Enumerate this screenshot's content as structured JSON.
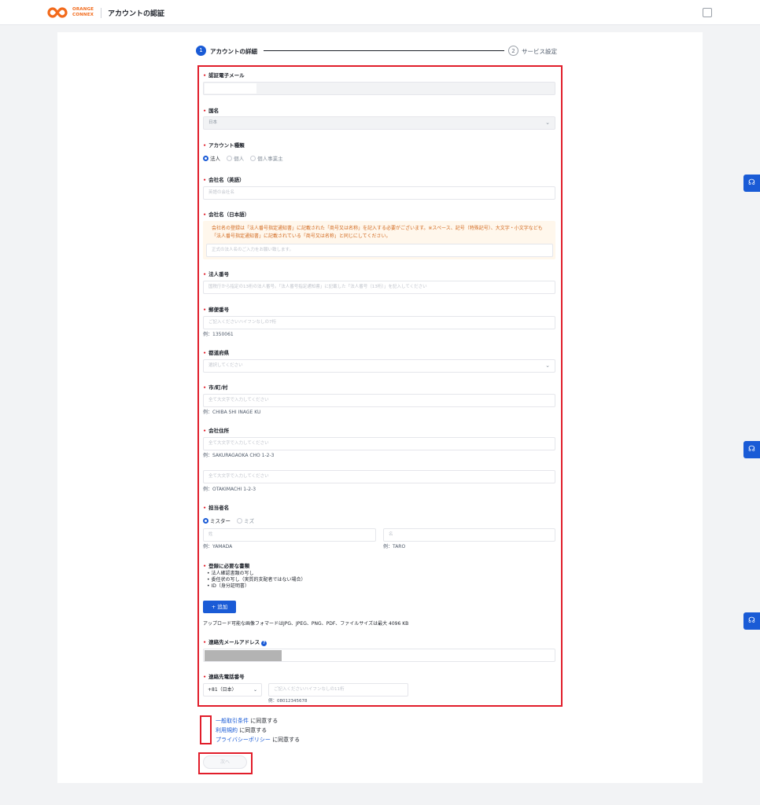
{
  "header": {
    "logo_text_line1": "ORANGE",
    "logo_text_line2": "CONNEX",
    "title": "アカウントの認証",
    "brand_color": "#f26a1b"
  },
  "steps": [
    {
      "number": "1",
      "label": "アカウントの詳細"
    },
    {
      "number": "2",
      "label": "サービス設定"
    }
  ],
  "form": {
    "email": {
      "label": "認証電子メール"
    },
    "country": {
      "label": "国名",
      "value": "日本"
    },
    "account_type": {
      "label": "アカウント種類",
      "options": [
        "法人",
        "個人",
        "個人事業主"
      ]
    },
    "company_en": {
      "label": "会社名（英語）",
      "placeholder": "英語の会社名"
    },
    "company_ja": {
      "label": "会社名（日本語）",
      "notice": "会社名の登録は「法人番号指定通知書」に記載された「商号又は名称」を記入する必要がございます。※スペース、記号（特殊記号）、大文字・小文字なども「法人番号指定通知書」に記載されている「商号又は名称」と同じにしてください。",
      "placeholder": "正式の法人名のご入力をお願い致します。"
    },
    "corp_number": {
      "label": "法人番号",
      "placeholder": "国税庁から指定の13桁の法人番号。「法人番号指定通知書」に記載した「法人番号（13桁）」を記入してください"
    },
    "postal": {
      "label": "郵便番号",
      "placeholder": "ご記入くださいハイフンなしの7桁",
      "example": "例：1350061"
    },
    "prefecture": {
      "label": "都道府県",
      "placeholder": "選択してください"
    },
    "city": {
      "label": "市/町/村",
      "placeholder": "全て大文字で入力してください",
      "example": "例：CHIBA SHI INAGE KU"
    },
    "address": {
      "label": "会社住所",
      "placeholder1": "全て大文字で入力してください",
      "example1": "例：SAKURAGAOKA CHO 1-2-3",
      "placeholder2": "全て大文字で入力してください",
      "example2": "例：OTAKIMACHI 1-2-3"
    },
    "contact_name": {
      "label": "担当者名",
      "options": [
        "ミスター",
        "ミズ"
      ],
      "last_placeholder": "姓",
      "first_placeholder": "名",
      "last_example": "例：YAMADA",
      "first_example": "例：TARO"
    },
    "documents": {
      "label": "登録に必要な書類",
      "items": [
        "法人確認書類の写し",
        "委任状の写し（実質的支配者ではない場合）",
        "ID（身分証明書）"
      ],
      "add_button": "+ 追加",
      "upload_note": "アップロード可能な画像フォマードはJPG、JPEG、PNG、PDF、ファイルサイズは最大 4096 KB"
    },
    "contact_email": {
      "label": "連絡先メールアドレス"
    },
    "phone": {
      "label": "連絡先電話番号",
      "country_code": "+81（日本）",
      "placeholder": "ご記入くださいハイフンなしの11桁",
      "example": "例：08012345678"
    }
  },
  "agreements": [
    {
      "link": "一般取引条件",
      "suffix": "に同意する"
    },
    {
      "link": "利用規約",
      "suffix": "に同意する"
    },
    {
      "link": "プライバシーポリシー",
      "suffix": "に同意する"
    }
  ],
  "next_button": "次へ",
  "colors": {
    "primary": "#1a5bd6",
    "highlight": "#e11d2a",
    "required": "#e11d2a"
  }
}
